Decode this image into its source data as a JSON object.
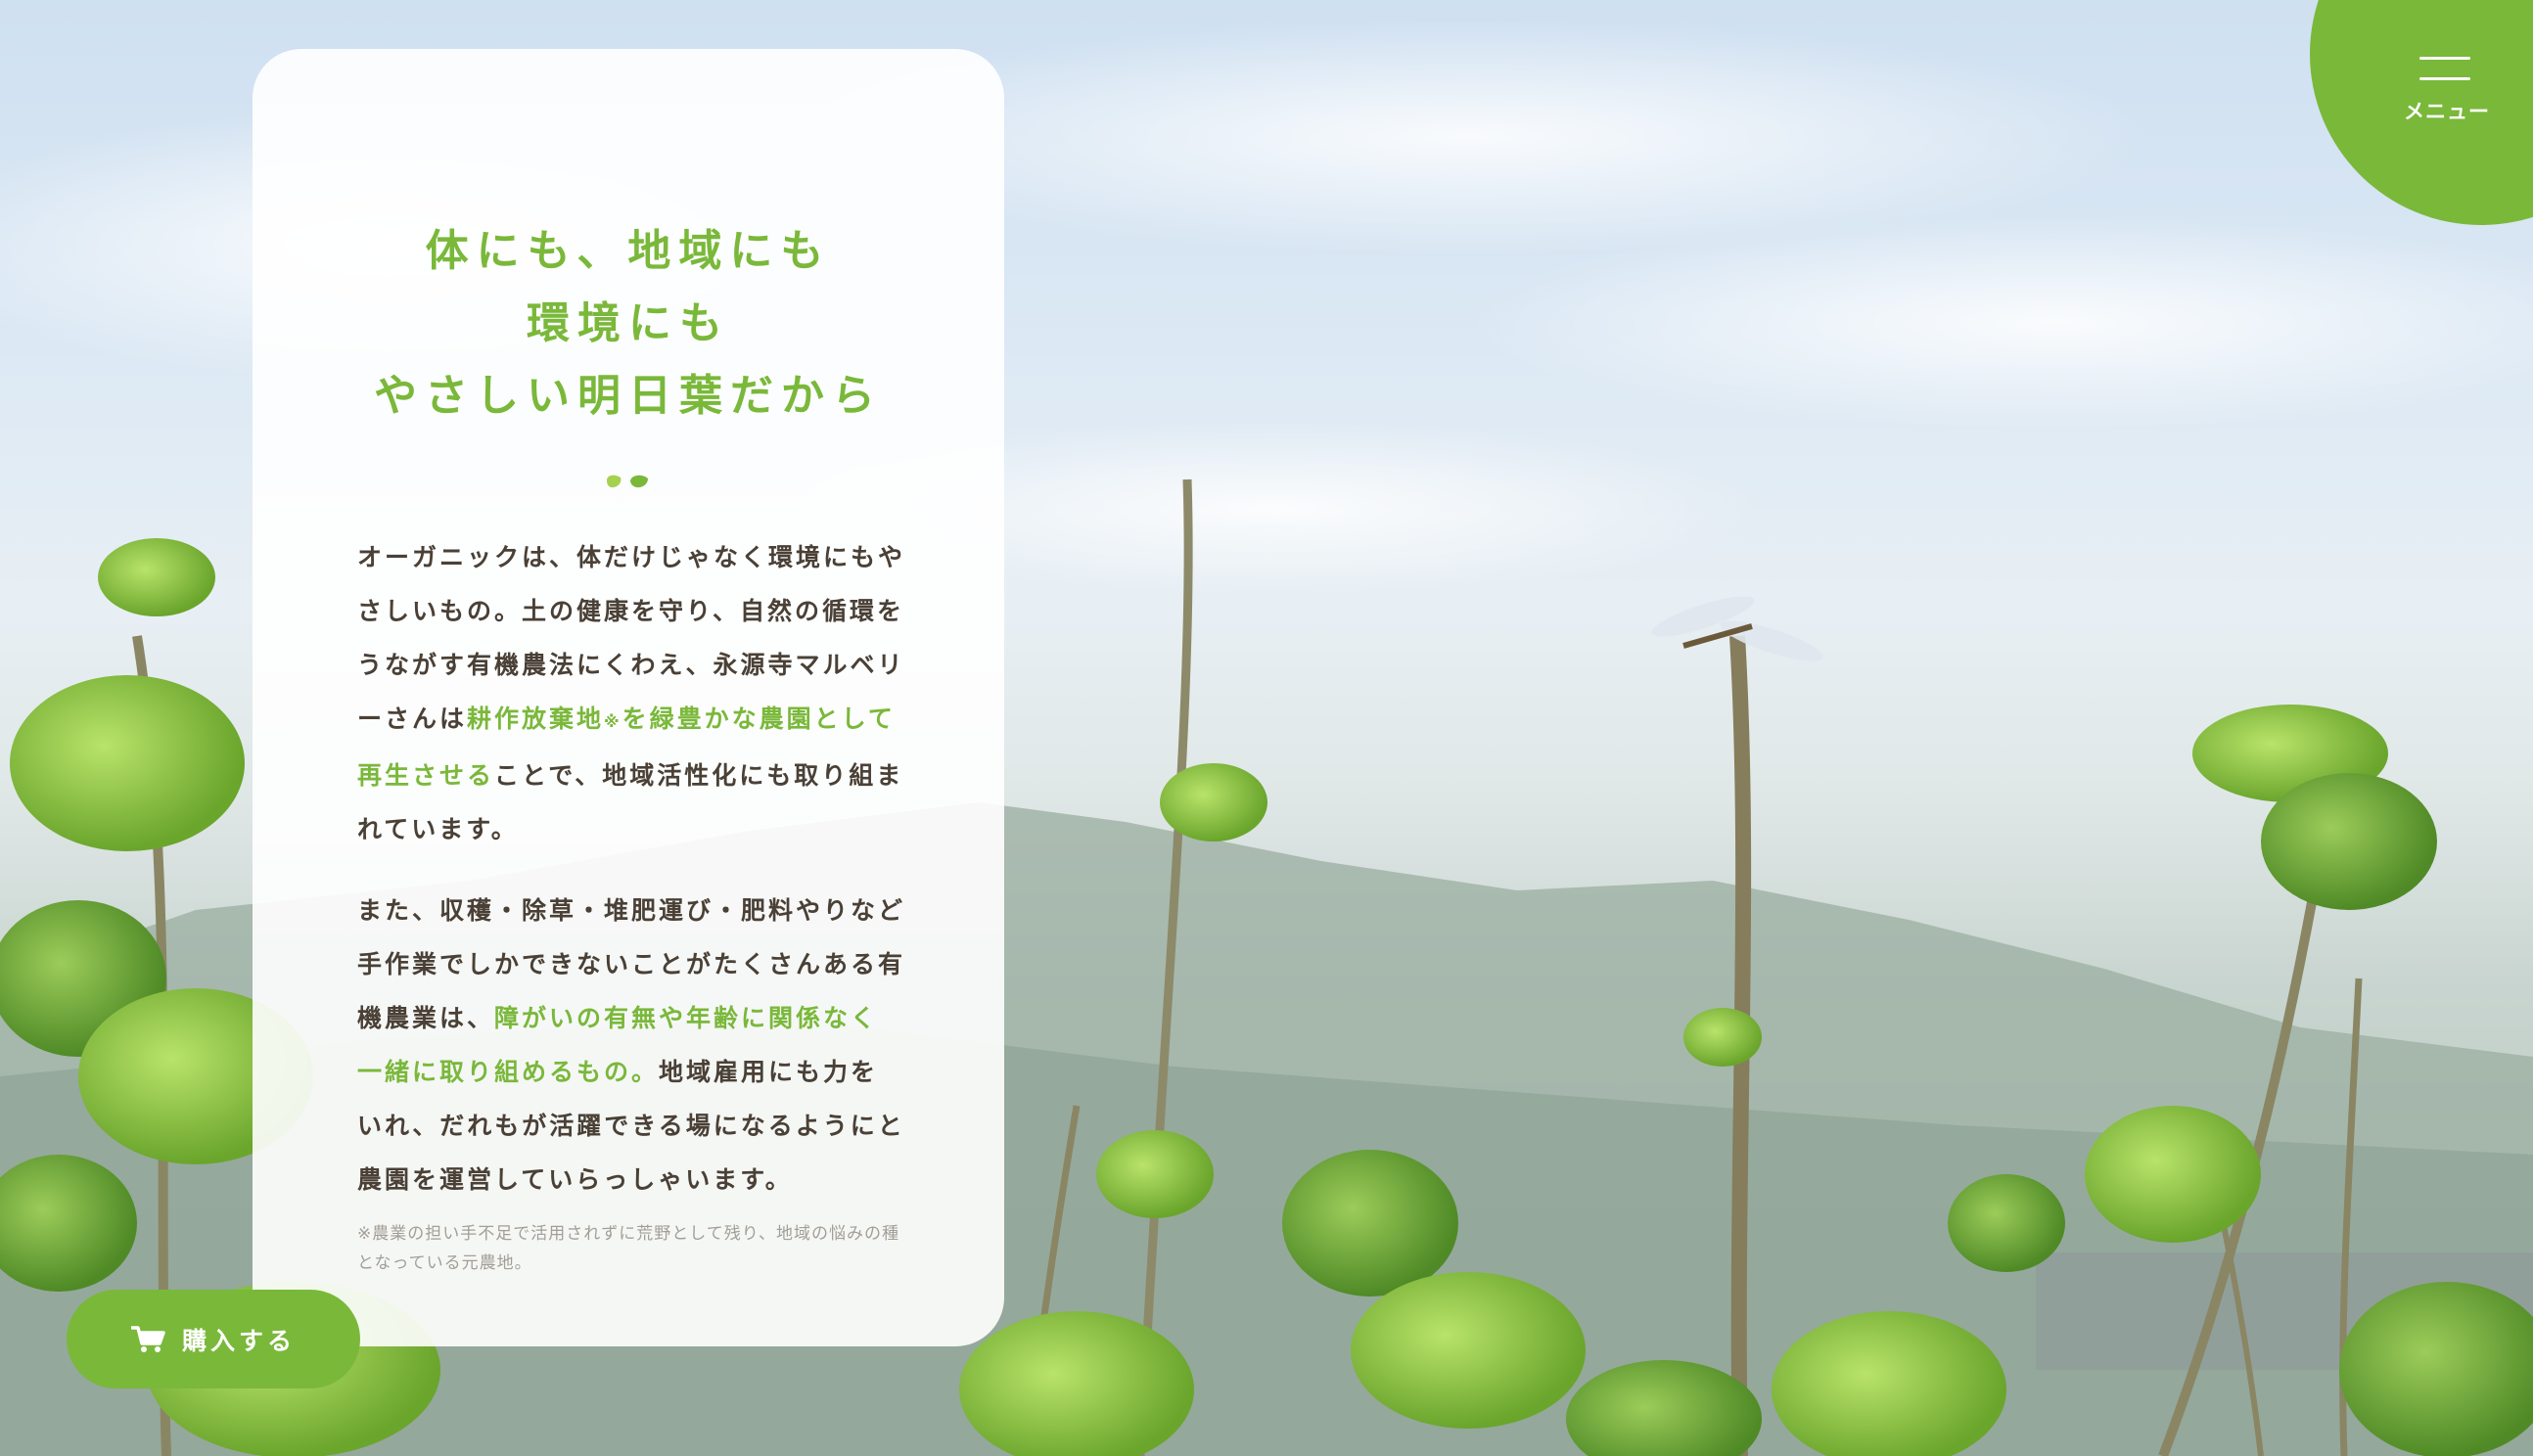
{
  "colors": {
    "accent": "#7ab83a",
    "body_text": "#4a4036",
    "footnote_text": "#a39e95",
    "card_bg": "#ffffff"
  },
  "header": {
    "menu_label": "メニュー",
    "menu_icon": "hamburger-icon"
  },
  "content": {
    "title_lines": [
      "体にも、地域にも",
      "環境にも",
      "やさしい明日葉だから"
    ],
    "divider_icon": "leaf-pair-icon",
    "p1": {
      "t1": "オーガニックは、体だけじゃなく環境にもやさしいもの。土の健康を守り、自然の循環をうながす有機農法にくわえ、永源寺マルベリーさんは",
      "h1": "耕作放棄地",
      "mark": "※",
      "h2": "を緑豊かな農園として再生させる",
      "t2": "ことで、地域活性化にも取り組まれています。"
    },
    "p2": {
      "t1": "また、収穫・除草・堆肥運び・肥料やりなど手作業でしかできないことがたくさんある有機農業は、",
      "h1": "障がいの有無や年齢に関係なく一緒に取り組めるもの。",
      "t2": "地域雇用にも力をいれ、だれもが活躍できる場になるようにと農園を運営していらっしゃいます。"
    },
    "footnote": "※農業の担い手不足で活用されずに荒野として残り、地域の悩みの種となっている元農地。"
  },
  "cta": {
    "buy_label": "購入する",
    "cart_icon": "cart-icon"
  }
}
